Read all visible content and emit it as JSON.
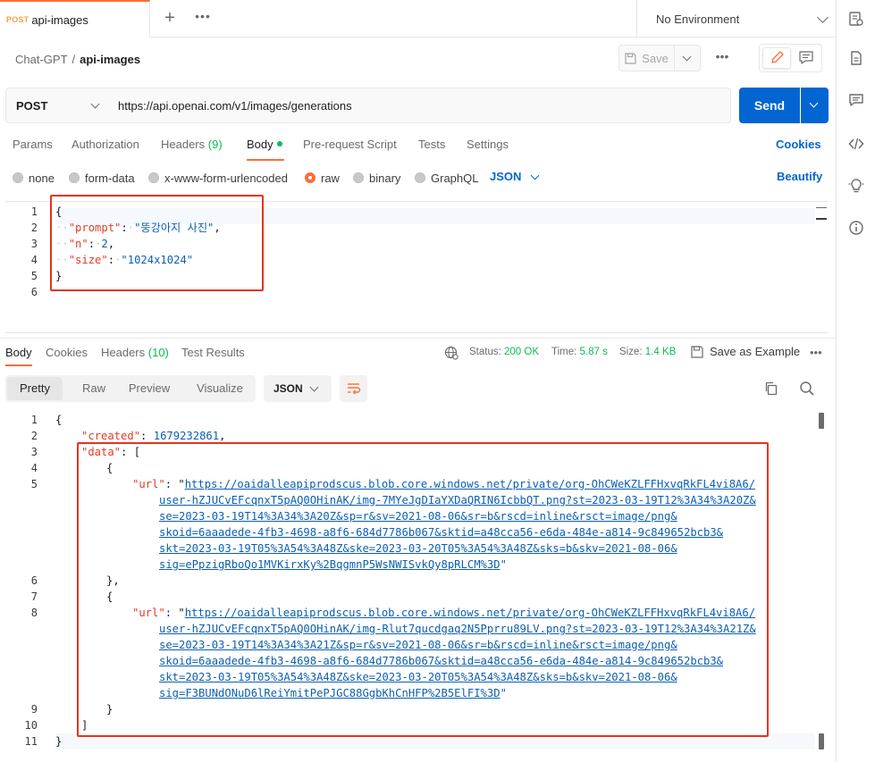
{
  "tab": {
    "method": "POST",
    "name": "api-images"
  },
  "environment": {
    "label": "No Environment"
  },
  "breadcrumb": {
    "workspace": "Chat-GPT",
    "separator": "/",
    "request": "api-images"
  },
  "toolbar": {
    "save_label": "Save"
  },
  "request": {
    "method": "POST",
    "url": "https://api.openai.com/v1/images/generations",
    "send_label": "Send"
  },
  "request_tabs": {
    "params": "Params",
    "authorization": "Authorization",
    "headers": "Headers",
    "headers_count": "(9)",
    "body": "Body",
    "prerequest": "Pre-request Script",
    "tests": "Tests",
    "settings": "Settings",
    "cookies": "Cookies"
  },
  "body_types": {
    "none": "none",
    "form_data": "form-data",
    "urlencoded": "x-www-form-urlencoded",
    "raw": "raw",
    "binary": "binary",
    "graphql": "GraphQL",
    "format": "JSON",
    "beautify": "Beautify"
  },
  "request_body": {
    "line_numbers": [
      "1",
      "2",
      "3",
      "4",
      "5",
      "6"
    ],
    "open": "{",
    "close": "}",
    "k_prompt": "\"prompt\"",
    "v_prompt": "\"뚱강아지 사진\"",
    "k_n": "\"n\"",
    "v_n": "2",
    "k_size": "\"size\"",
    "v_size": "\"1024x1024\""
  },
  "response_tabs": {
    "body": "Body",
    "cookies": "Cookies",
    "headers": "Headers",
    "headers_count": "(10)",
    "test_results": "Test Results"
  },
  "response_meta": {
    "status_label": "Status:",
    "status_value": "200 OK",
    "time_label": "Time:",
    "time_value": "5.87 s",
    "size_label": "Size:",
    "size_value": "1.4 KB",
    "save_example": "Save as Example"
  },
  "response_view": {
    "pretty": "Pretty",
    "raw": "Raw",
    "preview": "Preview",
    "visualize": "Visualize",
    "format": "JSON"
  },
  "response_body": {
    "line_numbers": [
      "1",
      "2",
      "3",
      "4",
      "5",
      "6",
      "7",
      "8",
      "9",
      "10",
      "11"
    ],
    "k_created": "\"created\"",
    "v_created": "1679232861",
    "k_data": "\"data\"",
    "k_url": "\"url\"",
    "url1": [
      "https://oaidalleapiprodscus.blob.core.windows.net/private/org-OhCWeKZLFFHxvqRkFL4vi8A6/",
      "user-hZJUCvEFcqnxT5pAQ0OHinAK/img-7MYeJgDIaYXDaQRIN6IcbbQT.png?st=2023-03-19T12%3A34%3A20Z&",
      "se=2023-03-19T14%3A34%3A20Z&sp=r&sv=2021-08-06&sr=b&rscd=inline&rsct=image/png&",
      "skoid=6aaadede-4fb3-4698-a8f6-684d7786b067&sktid=a48cca56-e6da-484e-a814-9c849652bcb3&",
      "skt=2023-03-19T05%3A54%3A48Z&ske=2023-03-20T05%3A54%3A48Z&sks=b&skv=2021-08-06&",
      "sig=ePpzigRboQo1MVKirxKy%2BqgmnP5WsNWISvkQy8pRLCM%3D"
    ],
    "url2": [
      "https://oaidalleapiprodscus.blob.core.windows.net/private/org-OhCWeKZLFFHxvqRkFL4vi8A6/",
      "user-hZJUCvEFcqnxT5pAQ0OHinAK/img-Rlut7qucdgaq2N5Pprru89LV.png?st=2023-03-19T12%3A34%3A21Z&",
      "se=2023-03-19T14%3A34%3A21Z&sp=r&sv=2021-08-06&sr=b&rscd=inline&rsct=image/png&",
      "skoid=6aaadede-4fb3-4698-a8f6-684d7786b067&sktid=a48cca56-e6da-484e-a814-9c849652bcb3&",
      "skt=2023-03-19T05%3A54%3A48Z&ske=2023-03-20T05%3A54%3A48Z&sks=b&skv=2021-08-06&",
      "sig=F3BUNdONuD6lReiYmitPePJGC88GgbKhCnHFP%2B5ElFI%3D"
    ]
  },
  "colors": {
    "accent": "#ff6c37",
    "primary": "#0265d2",
    "success": "#0cbb52",
    "json_key": "#e23b25",
    "json_value": "#0c5fb3",
    "annotation": "#e8321f"
  },
  "icons": {
    "rail": [
      "environment-icon",
      "documentation-icon",
      "comments-icon",
      "code-icon",
      "lightbulb-icon",
      "info-icon"
    ]
  }
}
